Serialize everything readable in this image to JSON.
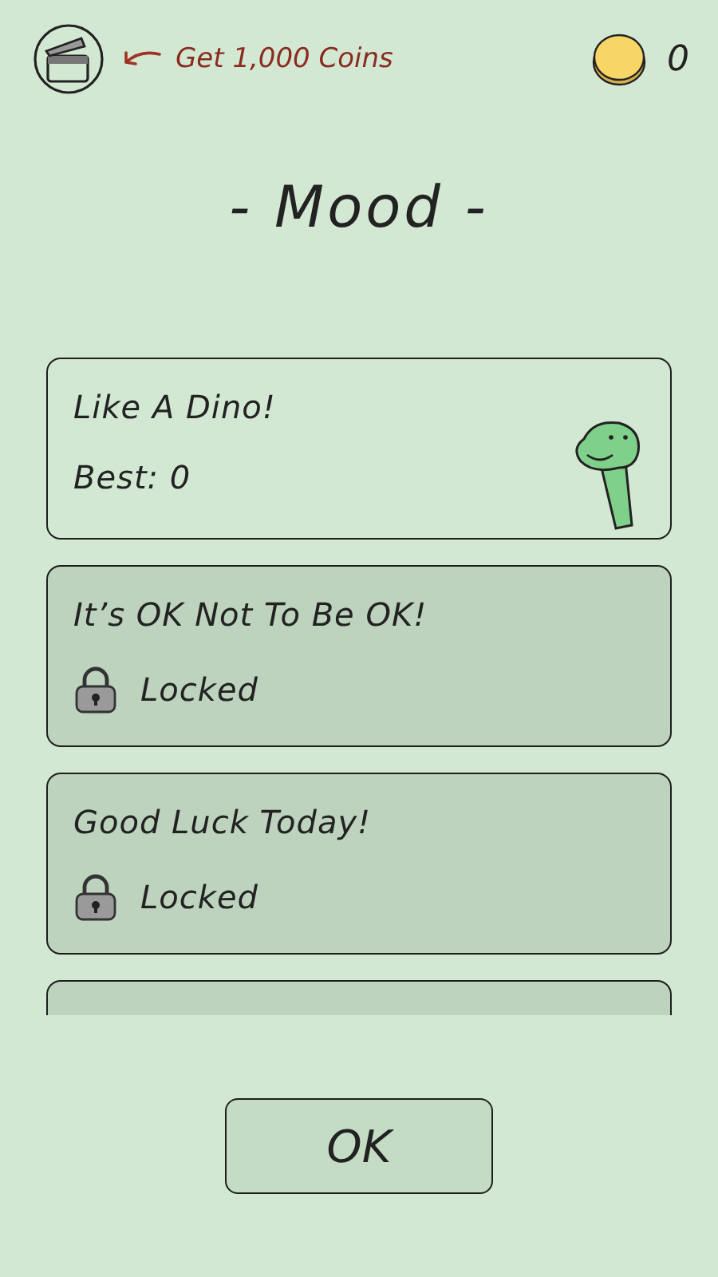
{
  "header": {
    "reward_text": "Get 1,000 Coins",
    "coins": "0"
  },
  "title": "- Mood -",
  "modes": [
    {
      "name": "Like A Dino!",
      "locked": false,
      "detail": "Best: 0"
    },
    {
      "name": "It’s OK Not To Be OK!",
      "locked": true,
      "detail": "Locked"
    },
    {
      "name": "Good Luck Today!",
      "locked": true,
      "detail": "Locked"
    },
    {
      "locked": true
    }
  ],
  "button": "OK"
}
